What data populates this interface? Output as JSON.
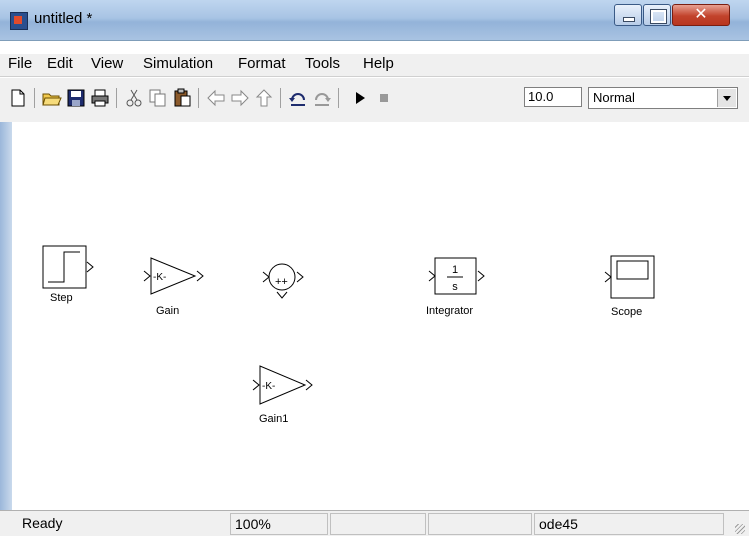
{
  "window": {
    "title": "untitled *"
  },
  "menu": [
    "File",
    "Edit",
    "View",
    "Simulation",
    "Format",
    "Tools",
    "Help"
  ],
  "toolbar": {
    "icons": [
      "new-model-icon",
      "open-icon",
      "save-icon",
      "print-icon",
      "cut-icon",
      "copy-icon",
      "paste-icon",
      "back-icon",
      "forward-icon",
      "up-icon",
      "undo-icon",
      "redo-icon",
      "start-simulation-icon",
      "stop-simulation-icon"
    ],
    "stop_time": "10.0",
    "sim_mode": "Normal"
  },
  "blocks": {
    "step": {
      "label": "Step"
    },
    "gain": {
      "label": "Gain",
      "symbol": "-K-"
    },
    "sum": {
      "signs": "++"
    },
    "integrator": {
      "label": "Integrator",
      "numerator": "1",
      "denominator": "s"
    },
    "scope": {
      "label": "Scope"
    },
    "gain1": {
      "label": "Gain1",
      "symbol": "-K-"
    }
  },
  "status": {
    "ready": "Ready",
    "zoom": "100%",
    "solver": "ode45"
  }
}
